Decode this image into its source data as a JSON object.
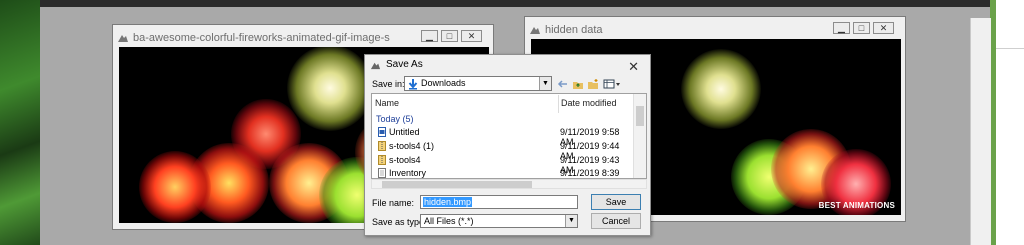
{
  "window_left": {
    "title": "ba-awesome-colorful-fireworks-animated-gif-image-s",
    "controls": [
      "minimize",
      "maximize",
      "close"
    ]
  },
  "window_right": {
    "title": "hidden data",
    "brand_text": "BEST ANIMATIONS",
    "controls": [
      "minimize",
      "maximize",
      "close"
    ]
  },
  "save_dialog": {
    "title": "Save As",
    "close_glyph": "✕",
    "save_in_label": "Save in:",
    "save_in_value": "Downloads",
    "columns": {
      "name": "Name",
      "date": "Date modified"
    },
    "group": "Today (5)",
    "files": [
      {
        "name": "Untitled",
        "date": "9/11/2019 9:58 AM",
        "icon": "image-file-icon"
      },
      {
        "name": "s-tools4 (1)",
        "date": "9/11/2019 9:44 AM",
        "icon": "zip-folder-icon"
      },
      {
        "name": "s-tools4",
        "date": "9/11/2019 9:43 AM",
        "icon": "zip-folder-icon"
      },
      {
        "name": "Inventory",
        "date": "9/11/2019 8:39 AM",
        "icon": "document-icon"
      }
    ],
    "file_name_label": "File name:",
    "file_name_value": "hidden.bmp",
    "save_as_type_label": "Save as type:",
    "save_as_type_value": "All Files (*.*)",
    "save_button": "Save",
    "cancel_button": "Cancel"
  },
  "colors": {
    "desktop": "#a9a9a9",
    "selection": "#3399ff",
    "group_header": "#1e3f99"
  }
}
